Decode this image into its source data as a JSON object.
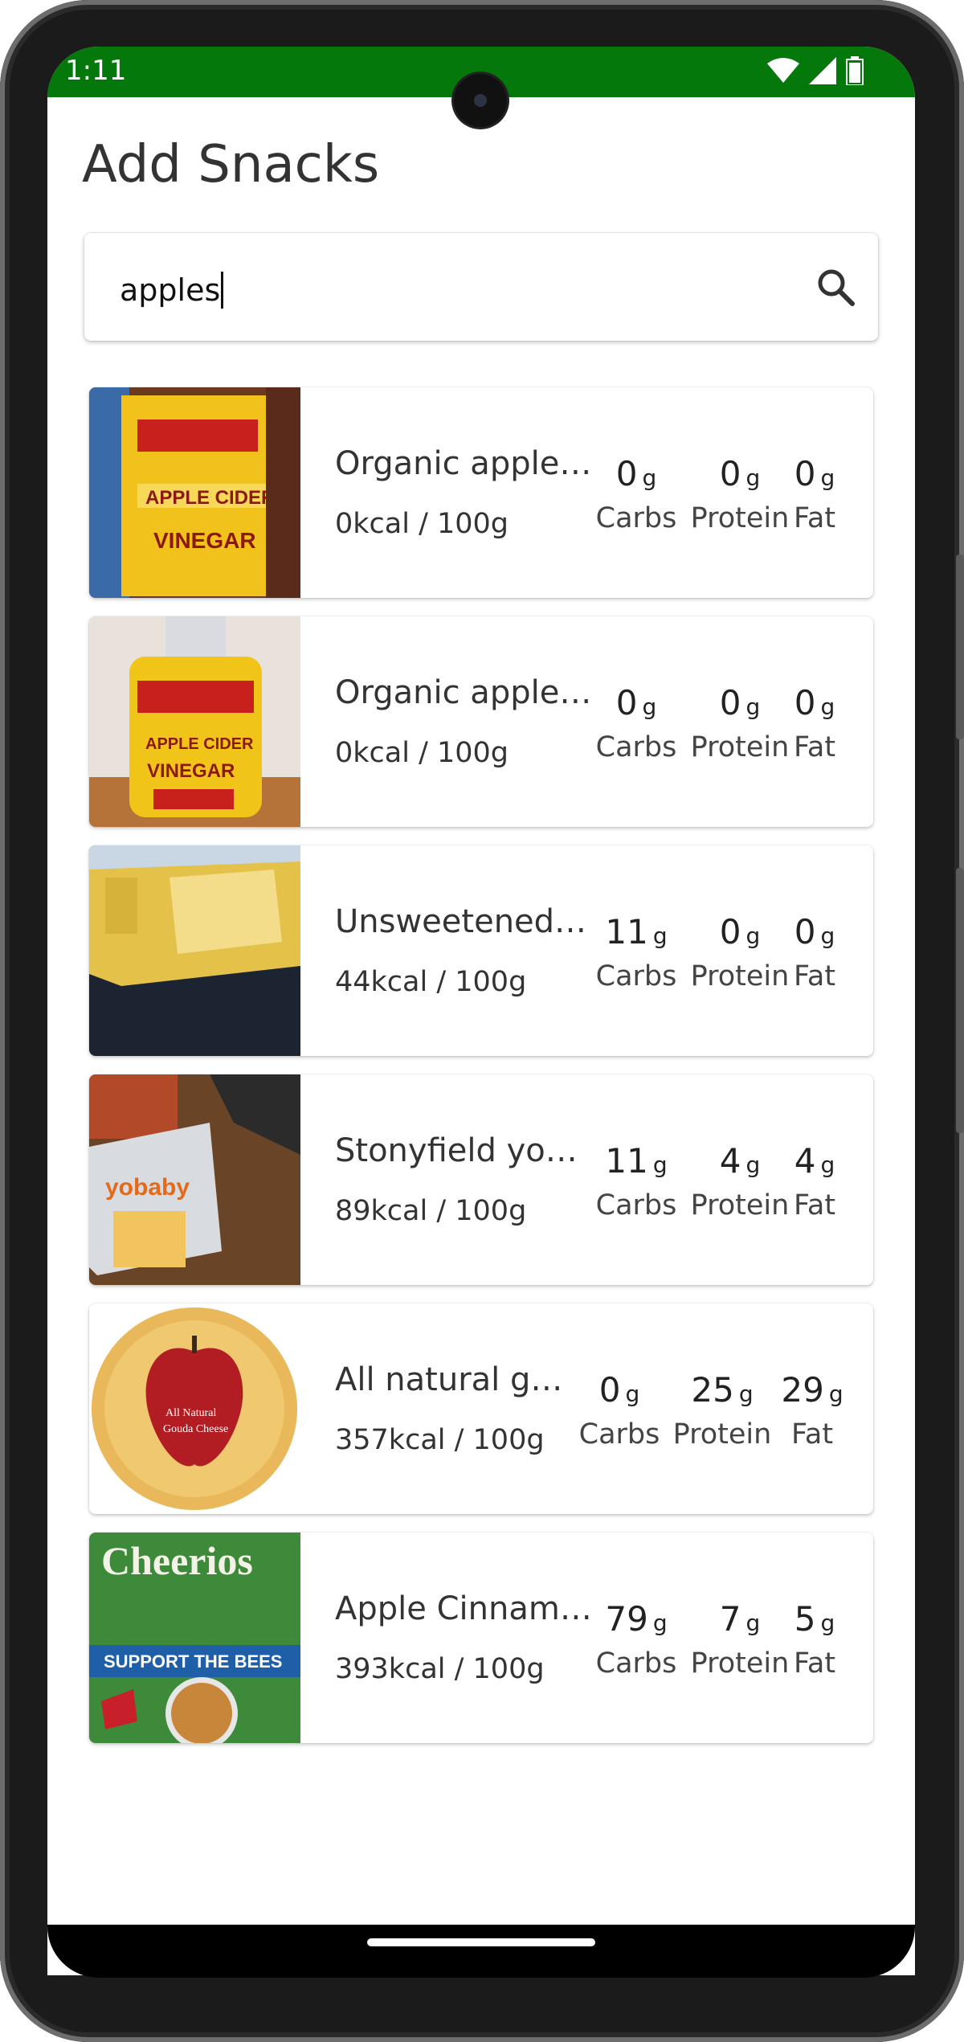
{
  "status_bar": {
    "time": "1:11",
    "color": "#04780b"
  },
  "page": {
    "title": "Add Snacks"
  },
  "search": {
    "value": "apples",
    "icon": "search-icon"
  },
  "units": {
    "gram": "g"
  },
  "macro_labels": {
    "carbs": "Carbs",
    "protein": "Protein",
    "fat": "Fat"
  },
  "snacks": [
    {
      "name": "Organic apple c...",
      "kcal": "0kcal / 100g",
      "carbs": "0",
      "protein": "0",
      "fat": "0",
      "image": "vinegar-bottle-label"
    },
    {
      "name": "Organic apple c...",
      "kcal": "0kcal / 100g",
      "carbs": "0",
      "protein": "0",
      "fat": "0",
      "image": "vinegar-bottle"
    },
    {
      "name": "Unsweetened a...",
      "kcal": "44kcal / 100g",
      "carbs": "11",
      "protein": "0",
      "fat": "0",
      "image": "applesauce-pouches"
    },
    {
      "name": "Stonyfield yoba...",
      "kcal": "89kcal / 100g",
      "carbs": "11",
      "protein": "4",
      "fat": "4",
      "image": "yobaby-package"
    },
    {
      "name": "All natural go...",
      "kcal": "357kcal / 100g",
      "carbs": "0",
      "protein": "25",
      "fat": "29",
      "image": "gouda-cheese"
    },
    {
      "name": "Apple Cinnamo...",
      "kcal": "393kcal / 100g",
      "carbs": "79",
      "protein": "7",
      "fat": "5",
      "image": "cheerios-box"
    }
  ]
}
